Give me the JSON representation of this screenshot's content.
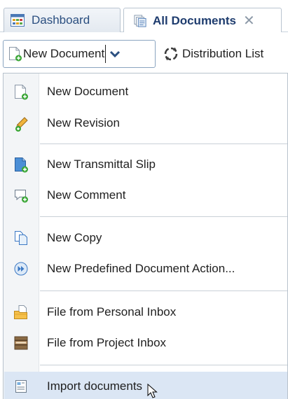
{
  "tabs": [
    {
      "label": "Dashboard",
      "icon": "dashboard-icon",
      "active": false
    },
    {
      "label": "All Documents",
      "icon": "documents-icon",
      "active": true,
      "close": "✕"
    }
  ],
  "toolbar": {
    "new_document_label": "New Document",
    "distribution_list_label": "Distribution List"
  },
  "menu": {
    "items": [
      {
        "label": "New Document",
        "icon": "new-document-icon"
      },
      {
        "label": "New Revision",
        "icon": "pencil-icon"
      },
      {
        "label": "New Transmittal Slip",
        "icon": "transmittal-icon"
      },
      {
        "label": "New Comment",
        "icon": "comment-icon"
      },
      {
        "label": "New Copy",
        "icon": "copy-icon"
      },
      {
        "label": "New Predefined Document Action...",
        "icon": "fast-forward-icon"
      },
      {
        "label": "File from Personal Inbox",
        "icon": "folder-icon"
      },
      {
        "label": "File from Project Inbox",
        "icon": "inbox-tray-icon"
      },
      {
        "label": "Import documents",
        "icon": "import-icon",
        "hovered": true
      }
    ]
  },
  "colors": {
    "accent": "#2b4f80",
    "hover": "#dbe6f4",
    "green_badge": "#3aa635"
  }
}
